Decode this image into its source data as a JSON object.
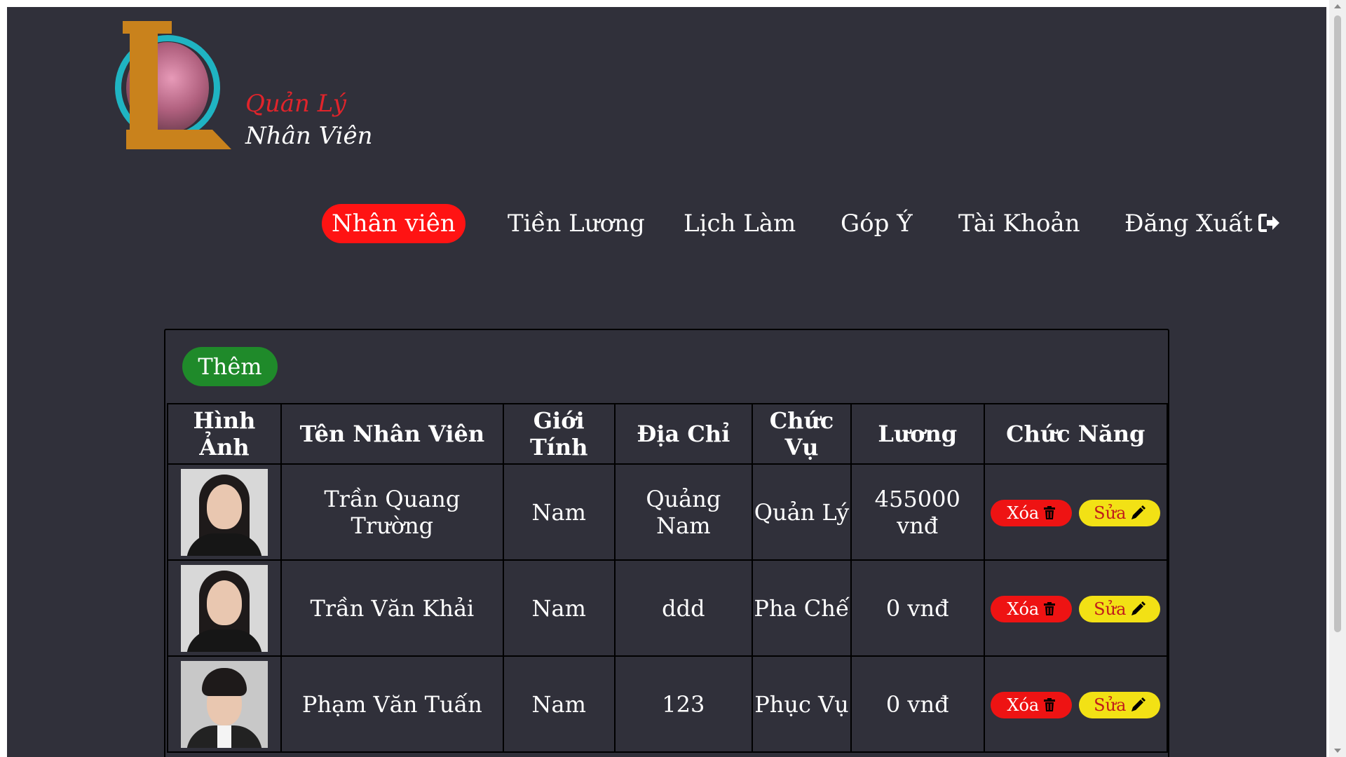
{
  "logo": {
    "line1": "Quản Lý",
    "line2": "Nhân Viên"
  },
  "nav": {
    "items": [
      {
        "label": "Nhân viên",
        "active": true
      },
      {
        "label": "Tiền Lương"
      },
      {
        "label": "Lịch Làm"
      },
      {
        "label": "Góp Ý"
      },
      {
        "label": "Tài Khoản"
      },
      {
        "label": "Đăng Xuất"
      }
    ],
    "logout_icon": "sign-out-icon"
  },
  "toolbar": {
    "add_label": "Thêm"
  },
  "table": {
    "headers": [
      "Hình Ảnh",
      "Tên Nhân Viên",
      "Giới Tính",
      "Địa Chỉ",
      "Chức Vụ",
      "Lương",
      "Chức Năng"
    ],
    "rows": [
      {
        "name": "Trần Quang Trường",
        "gender": "Nam",
        "address": "Quảng Nam",
        "position": "Quản Lý",
        "salary": "455000 vnđ"
      },
      {
        "name": "Trần Văn Khải",
        "gender": "Nam",
        "address": "ddd",
        "position": "Pha Chế",
        "salary": "0 vnđ"
      },
      {
        "name": "Phạm Văn Tuấn",
        "gender": "Nam",
        "address": "123",
        "position": "Phục Vụ",
        "salary": "0 vnđ"
      }
    ],
    "delete_label": "Xóa",
    "edit_label": "Sửa",
    "delete_icon": "trash-icon",
    "edit_icon": "pencil-icon"
  },
  "colors": {
    "background": "#30303a",
    "active_nav": "#ff1313",
    "add_button": "#1f8a2a",
    "delete_button": "#ee1313",
    "edit_button": "#f2e115"
  }
}
